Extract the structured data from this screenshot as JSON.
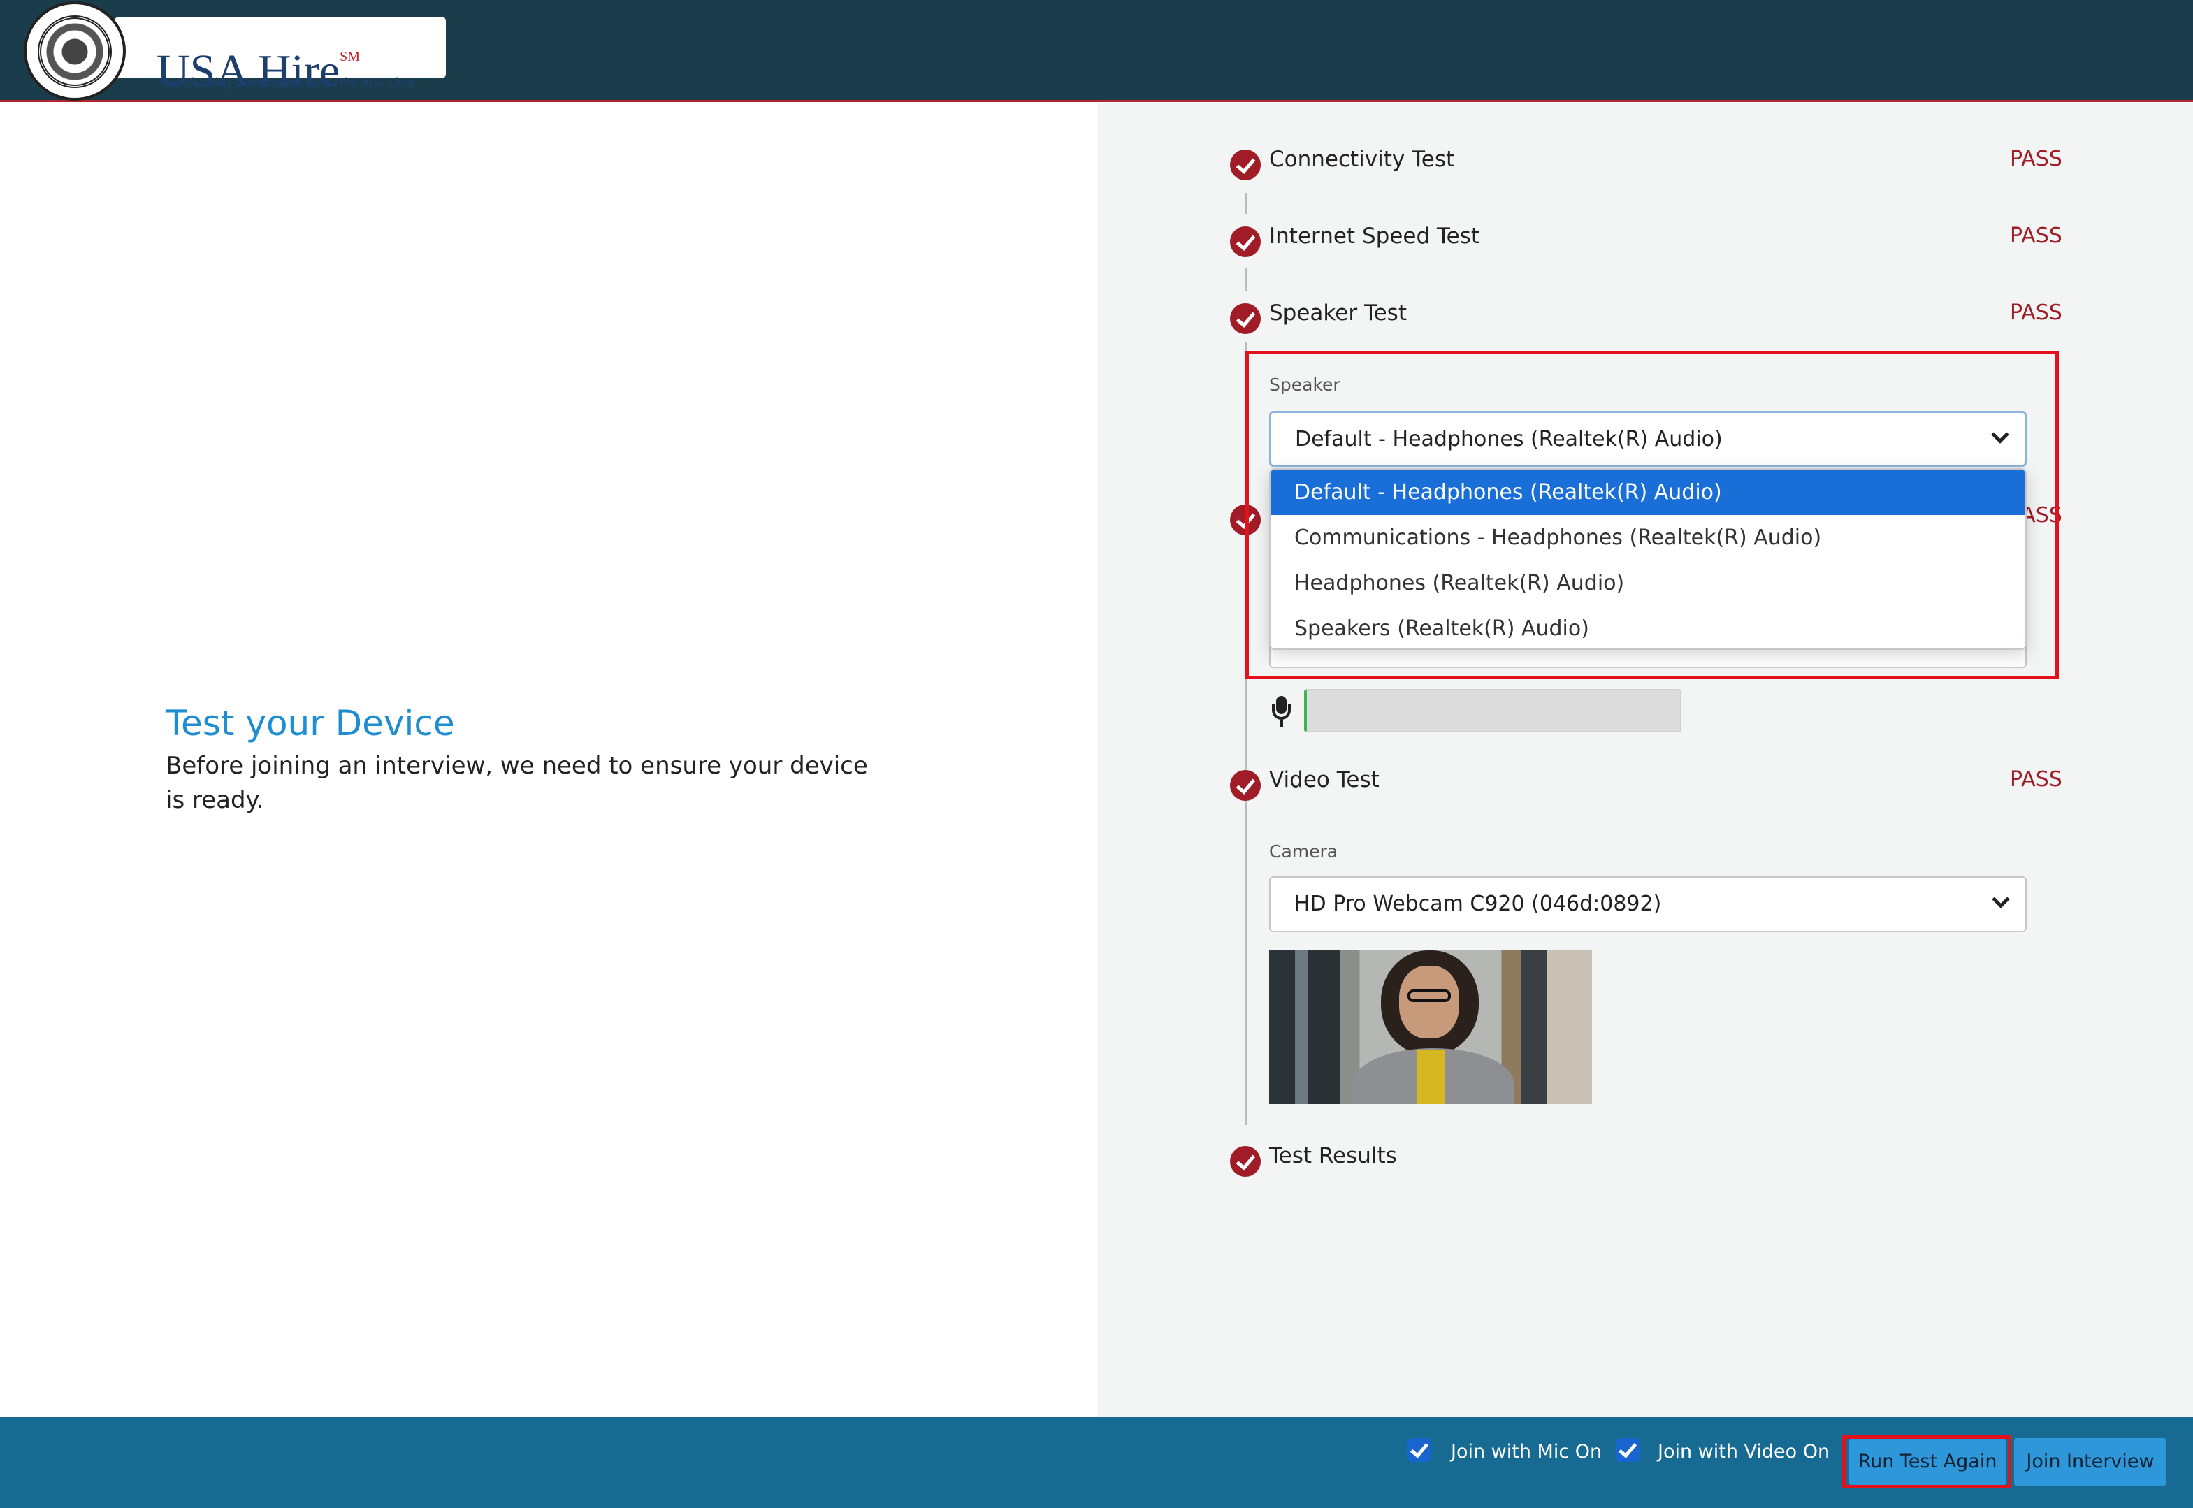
{
  "header": {
    "logo_title": "USA Hire",
    "logo_superscript": "SM",
    "logo_tagline": "Transforming Government One Hire At A Time"
  },
  "intro": {
    "heading": "Test your Device",
    "description": "Before joining an interview, we need to ensure your device is ready."
  },
  "steps": {
    "connectivity": {
      "label": "Connectivity Test",
      "status": "PASS"
    },
    "speed": {
      "label": "Internet Speed Test",
      "status": "PASS"
    },
    "speaker": {
      "label": "Speaker Test",
      "status": "PASS"
    },
    "microphone": {
      "status": "PASS"
    },
    "video": {
      "label": "Video Test",
      "status": "PASS"
    },
    "results": {
      "label": "Test Results"
    }
  },
  "speaker": {
    "field_label": "Speaker",
    "selected": "Default - Headphones (Realtek(R) Audio)",
    "options": [
      "Default - Headphones (Realtek(R) Audio)",
      "Communications - Headphones (Realtek(R) Audio)",
      "Headphones (Realtek(R) Audio)",
      "Speakers (Realtek(R) Audio)"
    ]
  },
  "camera": {
    "field_label": "Camera",
    "selected": "HD Pro Webcam C920 (046d:0892)"
  },
  "footer": {
    "mic_on_label": "Join with Mic On",
    "mic_on_checked": true,
    "video_on_label": "Join with Video On",
    "video_on_checked": true,
    "run_again_label": "Run Test Again",
    "join_label": "Join Interview"
  },
  "colors": {
    "header_bg": "#1b3d4b",
    "accent_red": "#a01c27",
    "heading_blue": "#1f8ed0",
    "footer_bg": "#176a92",
    "selected_option": "#1a6ed8",
    "highlight_box": "#e3111b"
  }
}
